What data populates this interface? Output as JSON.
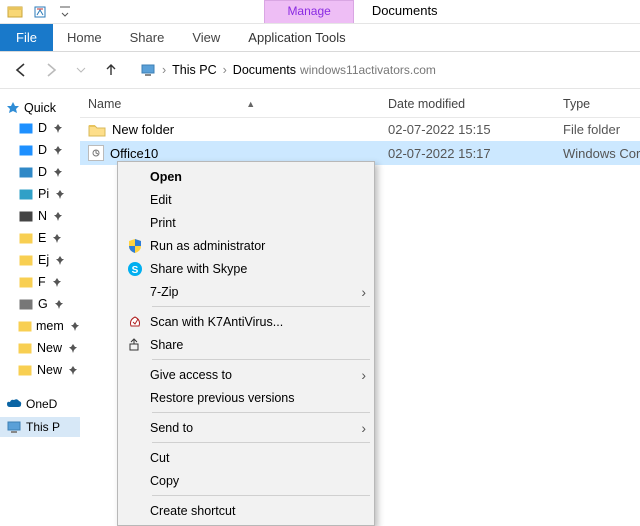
{
  "titlebar": {
    "manage_tab": "Manage",
    "doc_tab": "Documents"
  },
  "ribbon": {
    "file": "File",
    "home": "Home",
    "share": "Share",
    "view": "View",
    "app_tools": "Application Tools"
  },
  "breadcrumb": {
    "this_pc": "This PC",
    "documents": "Documents",
    "watermark": "windows11activators.com"
  },
  "columns": {
    "name": "Name",
    "date": "Date modified",
    "type": "Type"
  },
  "sidebar": {
    "quick": "Quick",
    "items": [
      {
        "label": "D",
        "icon_color": "#1E90FF"
      },
      {
        "label": "D",
        "icon_color": "#1E90FF"
      },
      {
        "label": "D",
        "icon_color": "#3089C7"
      },
      {
        "label": "Pi",
        "icon_color": "#30A0C7"
      },
      {
        "label": "N",
        "icon_color": "#444"
      },
      {
        "label": "E",
        "icon_color": "#F8CF52"
      },
      {
        "label": "Ej",
        "icon_color": "#F8CF52"
      },
      {
        "label": "F",
        "icon_color": "#F8CF52"
      },
      {
        "label": "G",
        "icon_color": "#777"
      },
      {
        "label": "mem",
        "icon_color": "#F8CF52"
      },
      {
        "label": "New",
        "icon_color": "#F8CF52"
      },
      {
        "label": "New",
        "icon_color": "#F8CF52"
      }
    ],
    "onedrive": "OneD",
    "thispc": "This P"
  },
  "files": [
    {
      "name": "New folder",
      "date": "02-07-2022 15:15",
      "type": "File folder"
    },
    {
      "name": "Office10",
      "date": "02-07-2022 15:17",
      "type": "Windows Cor"
    }
  ],
  "context_menu": {
    "open": "Open",
    "edit": "Edit",
    "print": "Print",
    "run_admin": "Run as administrator",
    "share_skype": "Share with Skype",
    "seven_zip": "7-Zip",
    "scan_k7": "Scan with K7AntiVirus...",
    "share": "Share",
    "give_access": "Give access to",
    "restore": "Restore previous versions",
    "send_to": "Send to",
    "cut": "Cut",
    "copy": "Copy",
    "create_shortcut": "Create shortcut"
  }
}
